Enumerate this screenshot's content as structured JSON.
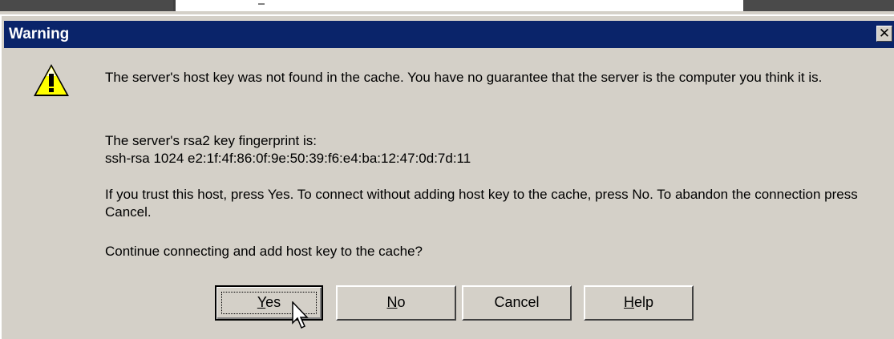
{
  "dialog": {
    "title": "Warning",
    "close_glyph": "✕",
    "icon": "warning-triangle-icon",
    "messages": {
      "line1": "The server's host key was not found in the cache. You have no guarantee that the server is the computer you think it is.",
      "line2": "The server's rsa2 key fingerprint is:",
      "line3": "ssh-rsa 1024 e2:1f:4f:86:0f:9e:50:39:f6:e4:ba:12:47:0d:7d:11",
      "line4": "If you trust this host, press Yes. To connect without adding host key to the cache, press No. To abandon the connection press Cancel.",
      "line5": "Continue connecting and add host key to the cache?"
    },
    "buttons": {
      "yes_mnemonic": "Y",
      "yes_rest": "es",
      "no_mnemonic": "N",
      "no_rest": "o",
      "cancel": "Cancel",
      "help_mnemonic": "H",
      "help_rest": "elp"
    }
  },
  "colors": {
    "titlebar": "#0a246a",
    "face": "#d4d0c8",
    "icon_yellow": "#ffff00"
  }
}
